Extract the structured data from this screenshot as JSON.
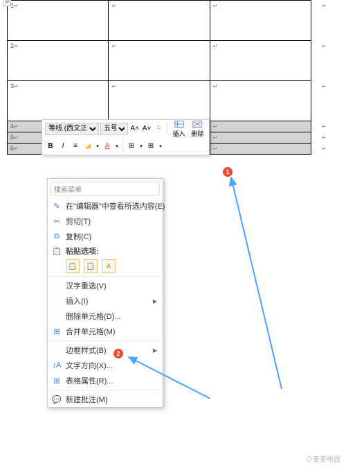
{
  "anchor": "⊕",
  "rows": [
    {
      "num": "1",
      "h": "tall"
    },
    {
      "num": "2",
      "h": "tall"
    },
    {
      "num": "3",
      "h": "tall"
    },
    {
      "num": "4",
      "h": "small"
    },
    {
      "num": "5",
      "h": "small"
    },
    {
      "num": "6",
      "h": "small"
    }
  ],
  "paraMark": "↵",
  "toolbar": {
    "font": "等线 (西文正文)",
    "size": "五号",
    "growA": "A˄",
    "shrinkA": "A˅",
    "format": "⯐",
    "bold": "B",
    "italic": "I",
    "align": "≡",
    "highlight": "◢",
    "fontcolor": "A",
    "border": "⊞",
    "arrow": "▾",
    "insert": "插入",
    "delete": "删除"
  },
  "menu": {
    "searchPlaceholder": "搜索菜单",
    "editor": "在\"编辑器\"中查看所选内容(E)",
    "cut": "剪切(T)",
    "copy": "复制(C)",
    "pasteOptions": "粘贴选项:",
    "hanzi": "汉字重选(V)",
    "insert": "插入(I)",
    "deleteCells": "删除单元格(D)...",
    "mergeCells": "合并单元格(M)",
    "borderStyle": "边框样式(B)",
    "textDirection": "文字方向(X)...",
    "tableProps": "表格属性(R)...",
    "newComment": "新建批注(M)"
  },
  "badges": {
    "one": "1",
    "two": "2"
  },
  "watermark": "⊙麦麦电器"
}
